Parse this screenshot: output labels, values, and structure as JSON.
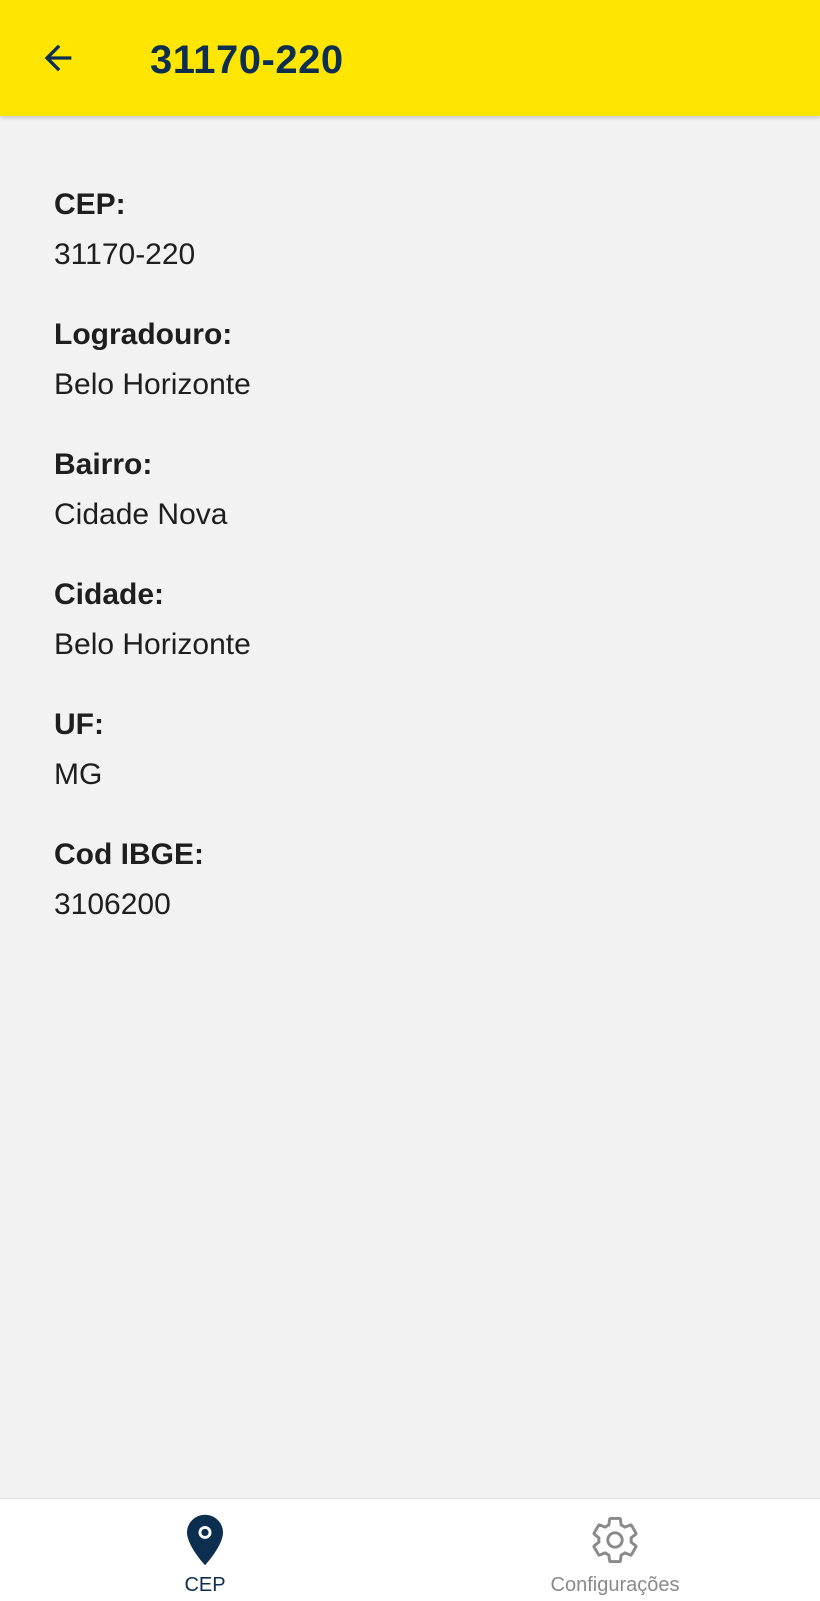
{
  "app_bar": {
    "title": "31170-220",
    "background_color": "#ffe600",
    "text_color": "#0d2f4f",
    "back_icon": "arrow-back-icon"
  },
  "fields": [
    {
      "label": "CEP:",
      "value": "31170-220"
    },
    {
      "label": "Logradouro:",
      "value": "Belo Horizonte"
    },
    {
      "label": "Bairro:",
      "value": "Cidade Nova"
    },
    {
      "label": "Cidade:",
      "value": "Belo Horizonte"
    },
    {
      "label": "UF:",
      "value": "MG"
    },
    {
      "label": "Cod IBGE:",
      "value": "3106200"
    }
  ],
  "bottom_nav": {
    "items": [
      {
        "label": "CEP",
        "icon": "location-pin-icon",
        "active": true
      },
      {
        "label": "Configurações",
        "icon": "gear-icon",
        "active": false
      }
    ],
    "active_color": "#0d2f4f",
    "inactive_color": "#8a8a8a"
  }
}
